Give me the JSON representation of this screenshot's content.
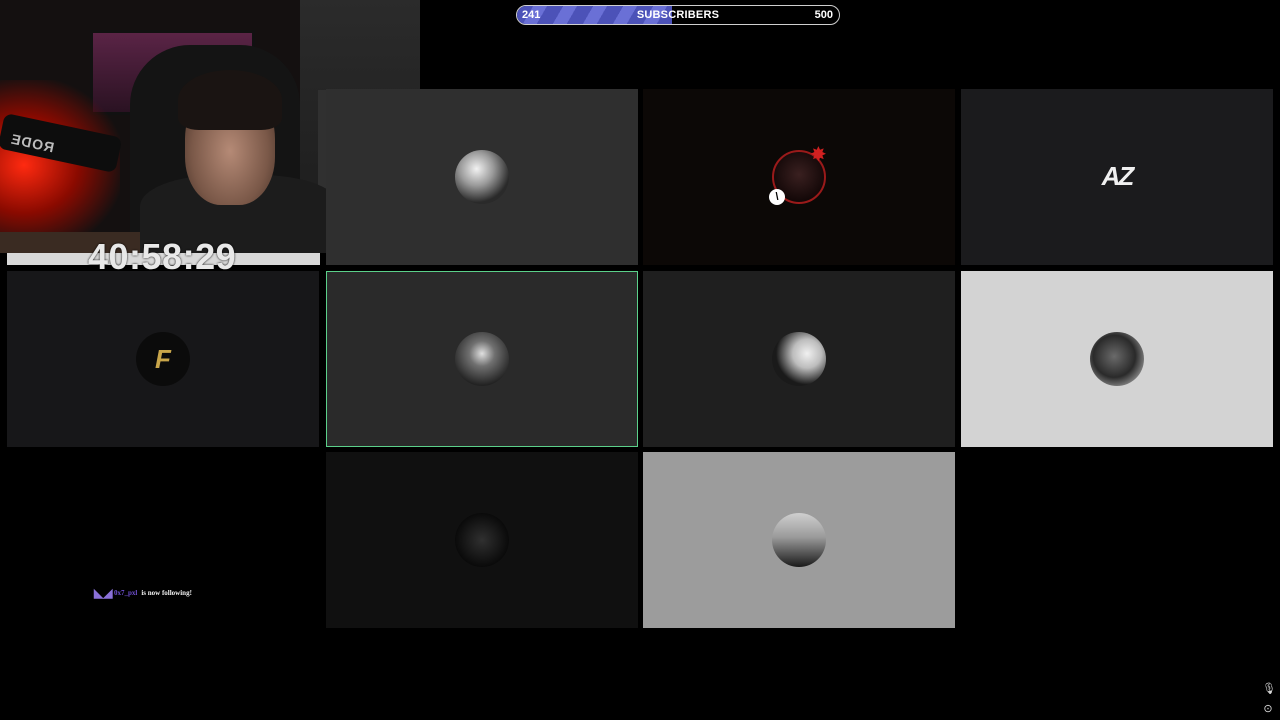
{
  "goal": {
    "current": "241",
    "label": "SUBSCRIBERS",
    "target": "500",
    "progress_fraction": 0.482
  },
  "webcam": {
    "mic_brand": "RODE"
  },
  "timer": {
    "value": "40:58:29"
  },
  "tiles": [
    {
      "id": "tile-1",
      "avatar": "grayscale-portrait-avatar"
    },
    {
      "id": "tile-2",
      "avatar": "red-ring-avatar",
      "badge": "\\"
    },
    {
      "id": "tile-3",
      "logo": "AZ"
    },
    {
      "id": "tile-4",
      "logo": "F"
    },
    {
      "id": "tile-5",
      "avatar": "light-beam-avatar",
      "highlighted": true
    },
    {
      "id": "tile-6",
      "avatar": "silhouette-avatar"
    },
    {
      "id": "tile-7",
      "avatar": "knight-avatar"
    },
    {
      "id": "tile-8",
      "avatar": "dark-warrior-avatar"
    },
    {
      "id": "tile-9",
      "avatar": "mountain-avatar"
    }
  ],
  "alert": {
    "username": "0x7_pxl",
    "message": "is now following!"
  },
  "icons": {
    "mic": "mic-icon",
    "settings": "settings-icon"
  },
  "colors": {
    "goal_fill": "#4c52b8",
    "highlight_border": "#5bd08a",
    "follow_name": "#6e4fd0",
    "gold": "#c9a64a"
  }
}
